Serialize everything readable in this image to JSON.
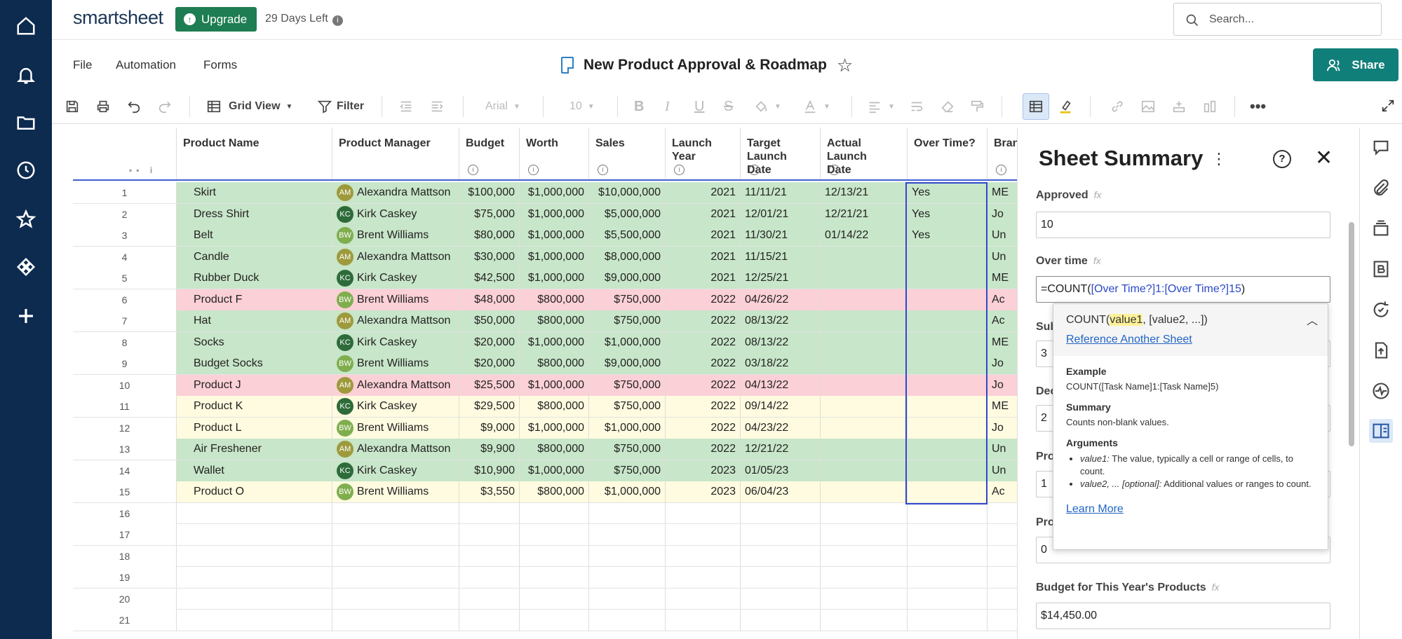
{
  "app": {
    "logo": "smartsheet",
    "upgrade_label": "Upgrade",
    "days_left": "29 Days Left",
    "search_placeholder": "Search..."
  },
  "menu": {
    "file": "File",
    "automation": "Automation",
    "forms": "Forms"
  },
  "sheet_title": "New Product Approval & Roadmap",
  "share_label": "Share",
  "toolbar": {
    "view": "Grid View",
    "filter": "Filter",
    "font": "Arial",
    "font_size": "10"
  },
  "columns": [
    "Product Name",
    "Product Manager",
    "Budget",
    "Worth",
    "Sales",
    "Launch Year",
    "Target Launch Date",
    "Actual Launch Date",
    "Over Time?",
    "Bran"
  ],
  "rows": [
    {
      "n": "1",
      "name": "Skirt",
      "init": "AM",
      "pm": "Alexandra Mattson",
      "budget": "$100,000",
      "worth": "$1,000,000",
      "sales": "$10,000,000",
      "year": "2021",
      "target": "11/11/21",
      "actual": "12/13/21",
      "over": "Yes",
      "brand": "ME",
      "color": "g"
    },
    {
      "n": "2",
      "name": "Dress Shirt",
      "init": "KC",
      "pm": "Kirk Caskey",
      "budget": "$75,000",
      "worth": "$1,000,000",
      "sales": "$5,000,000",
      "year": "2021",
      "target": "12/01/21",
      "actual": "12/21/21",
      "over": "Yes",
      "brand": "Jo",
      "color": "g"
    },
    {
      "n": "3",
      "name": "Belt",
      "init": "BW",
      "pm": "Brent Williams",
      "budget": "$80,000",
      "worth": "$1,000,000",
      "sales": "$5,500,000",
      "year": "2021",
      "target": "11/30/21",
      "actual": "01/14/22",
      "over": "Yes",
      "brand": "Un",
      "color": "g"
    },
    {
      "n": "4",
      "name": "Candle",
      "init": "AM",
      "pm": "Alexandra Mattson",
      "budget": "$30,000",
      "worth": "$1,000,000",
      "sales": "$8,000,000",
      "year": "2021",
      "target": "11/15/21",
      "actual": "",
      "over": "",
      "brand": "Un",
      "color": "g"
    },
    {
      "n": "5",
      "name": "Rubber Duck",
      "init": "KC",
      "pm": "Kirk Caskey",
      "budget": "$42,500",
      "worth": "$1,000,000",
      "sales": "$9,000,000",
      "year": "2021",
      "target": "12/25/21",
      "actual": "",
      "over": "",
      "brand": "ME",
      "color": "g"
    },
    {
      "n": "6",
      "name": "Product F",
      "init": "BW",
      "pm": "Brent Williams",
      "budget": "$48,000",
      "worth": "$800,000",
      "sales": "$750,000",
      "year": "2022",
      "target": "04/26/22",
      "actual": "",
      "over": "",
      "brand": "Ac",
      "color": "r"
    },
    {
      "n": "7",
      "name": "Hat",
      "init": "AM",
      "pm": "Alexandra Mattson",
      "budget": "$50,000",
      "worth": "$800,000",
      "sales": "$750,000",
      "year": "2022",
      "target": "08/13/22",
      "actual": "",
      "over": "",
      "brand": "Ac",
      "color": "g"
    },
    {
      "n": "8",
      "name": "Socks",
      "init": "KC",
      "pm": "Kirk Caskey",
      "budget": "$20,000",
      "worth": "$1,000,000",
      "sales": "$1,000,000",
      "year": "2022",
      "target": "08/13/22",
      "actual": "",
      "over": "",
      "brand": "ME",
      "color": "g"
    },
    {
      "n": "9",
      "name": "Budget Socks",
      "init": "BW",
      "pm": "Brent Williams",
      "budget": "$20,000",
      "worth": "$800,000",
      "sales": "$9,000,000",
      "year": "2022",
      "target": "03/18/22",
      "actual": "",
      "over": "",
      "brand": "Jo",
      "color": "g"
    },
    {
      "n": "10",
      "name": "Product J",
      "init": "AM",
      "pm": "Alexandra Mattson",
      "budget": "$25,500",
      "worth": "$1,000,000",
      "sales": "$750,000",
      "year": "2022",
      "target": "04/13/22",
      "actual": "",
      "over": "",
      "brand": "Jo",
      "color": "r"
    },
    {
      "n": "11",
      "name": "Product K",
      "init": "KC",
      "pm": "Kirk Caskey",
      "budget": "$29,500",
      "worth": "$800,000",
      "sales": "$750,000",
      "year": "2022",
      "target": "09/14/22",
      "actual": "",
      "over": "",
      "brand": "ME",
      "color": "y"
    },
    {
      "n": "12",
      "name": "Product L",
      "init": "BW",
      "pm": "Brent Williams",
      "budget": "$9,000",
      "worth": "$1,000,000",
      "sales": "$1,000,000",
      "year": "2022",
      "target": "04/23/22",
      "actual": "",
      "over": "",
      "brand": "Jo",
      "color": "y"
    },
    {
      "n": "13",
      "name": "Air Freshener",
      "init": "AM",
      "pm": "Alexandra Mattson",
      "budget": "$9,900",
      "worth": "$800,000",
      "sales": "$750,000",
      "year": "2022",
      "target": "12/21/22",
      "actual": "",
      "over": "",
      "brand": "Un",
      "color": "g"
    },
    {
      "n": "14",
      "name": "Wallet",
      "init": "KC",
      "pm": "Kirk Caskey",
      "budget": "$10,900",
      "worth": "$1,000,000",
      "sales": "$750,000",
      "year": "2023",
      "target": "01/05/23",
      "actual": "",
      "over": "",
      "brand": "Un",
      "color": "g"
    },
    {
      "n": "15",
      "name": "Product O",
      "init": "BW",
      "pm": "Brent Williams",
      "budget": "$3,550",
      "worth": "$800,000",
      "sales": "$1,000,000",
      "year": "2023",
      "target": "06/04/23",
      "actual": "",
      "over": "",
      "brand": "Ac",
      "color": "y"
    }
  ],
  "empty_rows": [
    "16",
    "17",
    "18",
    "19",
    "20",
    "21"
  ],
  "avatar_colors": {
    "AM": "#9e9a3c",
    "KC": "#2e6b3a",
    "BW": "#7fae4e"
  },
  "row_colors": {
    "g": "#c8e6c9",
    "r": "#fbd0d6",
    "y": "#fffbe0"
  },
  "summary": {
    "title": "Sheet Summary",
    "approved_label": "Approved",
    "approved_value": "10",
    "overtime_label": "Over time",
    "overtime_formula_prefix": "=COUNT(",
    "overtime_formula_ref": "[Over Time?]1:[Over Time?]15",
    "overtime_formula_suffix": ")",
    "sub_label": "Sub",
    "sub_value": "3",
    "dec_label": "Dec",
    "dec_value": "2",
    "pro1_label": "Pro",
    "pro1_value": "1",
    "pro2_label": "Pro",
    "pro2_value": "0",
    "budget_label": "Budget for This Year's Products",
    "budget_value": "$14,450.00",
    "fx": "fx"
  },
  "popup": {
    "sig_fn": "COUNT(",
    "sig_arg": "value1",
    "sig_rest": ", [value2, ...])",
    "ref_link": "Reference Another Sheet",
    "example_h": "Example",
    "example_v": "COUNT([Task Name]1:[Task Name]5)",
    "summary_h": "Summary",
    "summary_v": "Counts non-blank values.",
    "args_h": "Arguments",
    "arg1_name": "value1:",
    "arg1_desc": " The value, typically a cell or range of cells, to count.",
    "arg2_name": "value2, ... [optional]:",
    "arg2_desc": " Additional values or ranges to count.",
    "learn": "Learn More"
  }
}
